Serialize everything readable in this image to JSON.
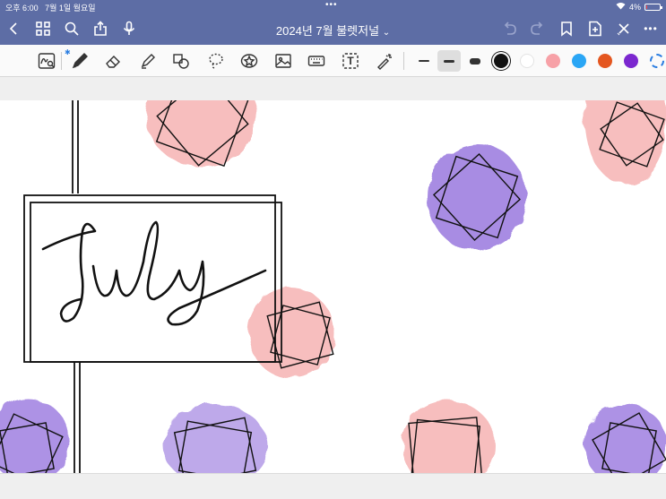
{
  "status_bar": {
    "time": "오후 6:00",
    "date": "7월 1일 월요일",
    "multitask_dots": "•••",
    "battery_percent": "4%",
    "battery_level": 0.04
  },
  "nav": {
    "title": "2024년 7월 불렛저널",
    "title_chevron": "⌄",
    "icons": [
      "back-icon",
      "grid-icon",
      "search-icon",
      "share-icon",
      "mic-icon",
      "undo-icon",
      "redo-icon",
      "bookmark-icon",
      "add-page-icon",
      "close-icon",
      "more-icon"
    ],
    "more_label": "•••"
  },
  "toolbar": {
    "tools": [
      "handwriting-recognition",
      "pen",
      "eraser",
      "highlighter",
      "shapes",
      "lasso",
      "sticker",
      "image",
      "keyboard",
      "text",
      "laser-pointer"
    ],
    "text_tool_label": "T",
    "thickness_options": [
      "thin",
      "medium",
      "thick"
    ],
    "selected_thickness": "medium",
    "colors": [
      "#111111",
      "#ffffff",
      "#f7a1a7",
      "#2aa6f5",
      "#e4561f",
      "#7b27cf"
    ],
    "selected_color": "#111111"
  },
  "canvas": {
    "handwritten_text": "July",
    "palette": {
      "pink": "#f6b3b3",
      "purple": "#9f7fe0",
      "ink": "#111111"
    }
  }
}
